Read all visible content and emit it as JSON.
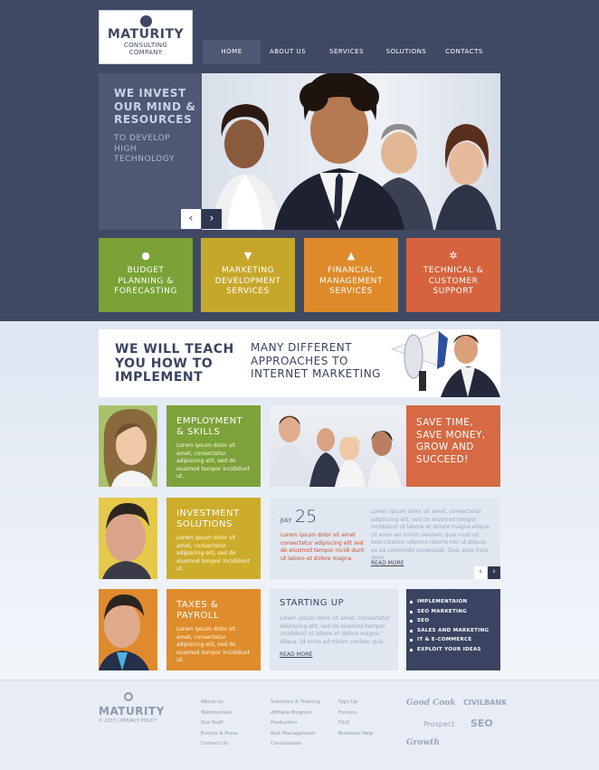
{
  "header": {
    "logo_title": "MATURITY",
    "logo_sub1": "CONSULTING",
    "logo_sub2": "COMPANY"
  },
  "nav": [
    {
      "label": "HOME",
      "active": true
    },
    {
      "label": "ABOUT US"
    },
    {
      "label": "SERVICES"
    },
    {
      "label": "SOLUTIONS"
    },
    {
      "label": "CONTACTS"
    }
  ],
  "hero": {
    "line1": "WE INVEST",
    "line2": "OUR MIND &",
    "line3": "RESOURCES",
    "sub1": "TO DEVELOP",
    "sub2": "HIGH",
    "sub3": "TECHNOLOGY",
    "prev": "‹",
    "next": "›"
  },
  "tiles": [
    {
      "icon": "piggy-bank-icon",
      "glyph": "●",
      "l1": "BUDGET",
      "l2": "PLANNING &",
      "l3": "FORECASTING",
      "color": "#7aa236"
    },
    {
      "icon": "basket-icon",
      "glyph": "▼",
      "l1": "MARKETING",
      "l2": "DEVELOPMENT",
      "l3": "SERVICES",
      "color": "#c6a72a"
    },
    {
      "icon": "chart-icon",
      "glyph": "▲",
      "l1": "FINANCIAL",
      "l2": "MANAGEMENT",
      "l3": "SERVICES",
      "color": "#de8a2a"
    },
    {
      "icon": "gears-icon",
      "glyph": "✲",
      "l1": "TECHNICAL &",
      "l2": "CUSTOMER",
      "l3": "SUPPORT",
      "color": "#d5643e"
    }
  ],
  "banner": {
    "b1": "WE WILL TEACH",
    "b2": "YOU HOW TO",
    "b3": "IMPLEMENT",
    "r1": "MANY DIFFERENT",
    "r2": "APPROACHES TO",
    "r3": "INTERNET MARKETING"
  },
  "cards": [
    {
      "t1": "EMPLOYMENT",
      "t2": "& SKILLS",
      "text": "Lorem ipsum dolor sit amet, consectetur adipiscing elit, sed do eiusmod tempor incididunt ut.",
      "color": "#7da23a"
    },
    {
      "t1": "INVESTMENT",
      "t2": "SOLUTIONS",
      "text": "Lorem ipsum dolor sit amet, consectetur adipiscing elit, sed do eiusmod tempor incididunt ut.",
      "color": "#cdac2b"
    },
    {
      "t1": "TAXES &",
      "t2": "PAYROLL",
      "text": "Lorem ipsum dolor sit amet, consectetur adipiscing elit, sed do eiusmod tempor incididunt ut.",
      "color": "#df8c2c"
    }
  ],
  "save": {
    "l1": "SAVE TIME,",
    "l2": "SAVE MONEY,",
    "l3": "GROW AND",
    "l4": "SUCCEED!"
  },
  "news": {
    "month": "JULY",
    "day": "25",
    "lead": "Lorem ipsum dolor sit amet consectetur adipiscing elit sed do eiusmod tempor incidi-dunt ut labore et dolore magna.",
    "body": "Lorem ipsum dolor sit amet, consectetur adipiscing elit, sed do eiusmod tempor incididunt ut labore et dolore magna aliqua. Ut enim ad minim veniam, quis nostrud exer-citation ullamco laboris nisi ut aliquip ex ea commodo consequat. Duis aute irure dolor.",
    "more": "READ MORE",
    "prev": "‹",
    "next": "›"
  },
  "start": {
    "title": "STARTING UP",
    "text": "Lorem ipsum dolor sit amet, consectetur adipiscing elit, sed do eiusmod tempor incididunt ut labore et dolore magna aliqua. Ut enim ad minim veniam quis.",
    "more": "READ MORE"
  },
  "list": [
    "IMPLEMENTAION",
    "SEO MARKETING",
    "SEO",
    "SALES AND MARKETING",
    "IT & E-COMMERCE",
    "EXPLOIT YOUR IDEAS"
  ],
  "footer": {
    "logo": "MATURITY",
    "copy": "© 2013 | PRIVACY POLICY",
    "col1": [
      "About Us",
      "Testimonials",
      "Our Staff",
      "Events & Press",
      "Contact Us"
    ],
    "col2": [
      "Solutions & Training",
      "Affiliate Program",
      "Production",
      "Risk Management",
      "Consultation"
    ],
    "col3": [
      "Sign Up",
      "Forums",
      "F&Q",
      "Business Help"
    ],
    "brands": [
      "Good Cook",
      "CIVILBANK",
      "Prospect",
      "SEO",
      "Growth"
    ]
  }
}
